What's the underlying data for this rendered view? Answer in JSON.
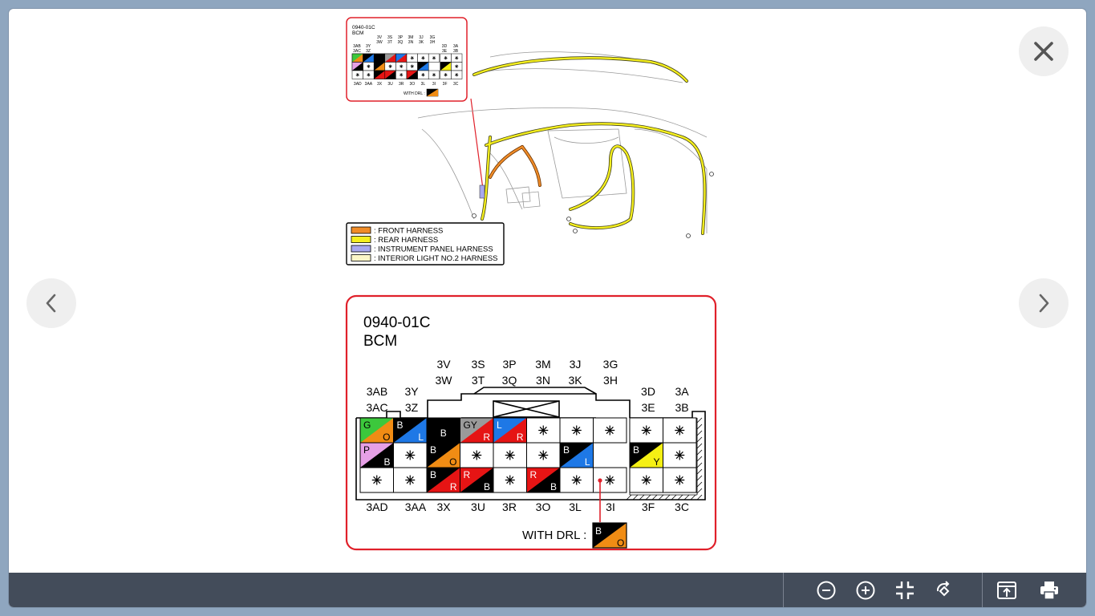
{
  "inset": {
    "code": "0940-01C",
    "name": "BCM",
    "with_drl": "WITH DRL :",
    "top_labels": [
      [
        "3V",
        "3W"
      ],
      [
        "3S",
        "3T"
      ],
      [
        "3P",
        "3Q"
      ],
      [
        "3M",
        "3N"
      ],
      [
        "3J",
        "3K"
      ],
      [
        "3G",
        "3H"
      ]
    ],
    "left_labels": [
      [
        "3AB",
        "3AC"
      ],
      [
        "3Y",
        "3Z"
      ]
    ],
    "right_labels": [
      [
        "3D",
        "3E"
      ],
      [
        "3A",
        "3B"
      ]
    ],
    "bottom_labels": [
      "3AD",
      "3AA",
      "3X",
      "3U",
      "3R",
      "3O",
      "3L",
      "3I",
      "3F",
      "3C"
    ]
  },
  "legend": [
    {
      "color": "#f08c28",
      "label": ": FRONT HARNESS"
    },
    {
      "color": "#f5ef1e",
      "label": ": REAR HARNESS"
    },
    {
      "color": "#a8a8f0",
      "label": ": INSTRUMENT PANEL HARNESS"
    },
    {
      "color": "#fbf6c8",
      "label": ": INTERIOR LIGHT NO.2 HARNESS"
    }
  ],
  "connector": {
    "code": "0940-01C",
    "name": "BCM",
    "top_labels": [
      [
        "3V",
        "3W"
      ],
      [
        "3S",
        "3T"
      ],
      [
        "3P",
        "3Q"
      ],
      [
        "3M",
        "3N"
      ],
      [
        "3J",
        "3K"
      ],
      [
        "3G",
        "3H"
      ]
    ],
    "left_labels": [
      [
        "3AB",
        "3AC"
      ],
      [
        "3Y",
        "3Z"
      ]
    ],
    "right_labels": [
      [
        "3D",
        "3E"
      ],
      [
        "3A",
        "3B"
      ]
    ],
    "bottom_labels": [
      "3AD",
      "3AA",
      "3X",
      "3U",
      "3R",
      "3O",
      "3L",
      "3I",
      "3F",
      "3C"
    ],
    "with_drl": "WITH DRL :",
    "drl_wire": {
      "top": "B",
      "bottom": "O"
    }
  },
  "colors": {
    "B": "#000000",
    "L": "#1e78e6",
    "O": "#f08c14",
    "R": "#e61414",
    "G": "#3cc83c",
    "GY": "#9a9a9a",
    "P": "#e6a0e6",
    "Y": "#f5f014",
    "W": "#ffffff",
    "frame_red": "#e0202a",
    "toolbar": "#434c5a"
  },
  "toolbar": {
    "zoom_out": "zoom-out-icon",
    "zoom_in": "zoom-in-icon",
    "fit": "fit-icon",
    "rotate": "rotate-icon",
    "open": "open-new-icon",
    "print": "print-icon"
  }
}
